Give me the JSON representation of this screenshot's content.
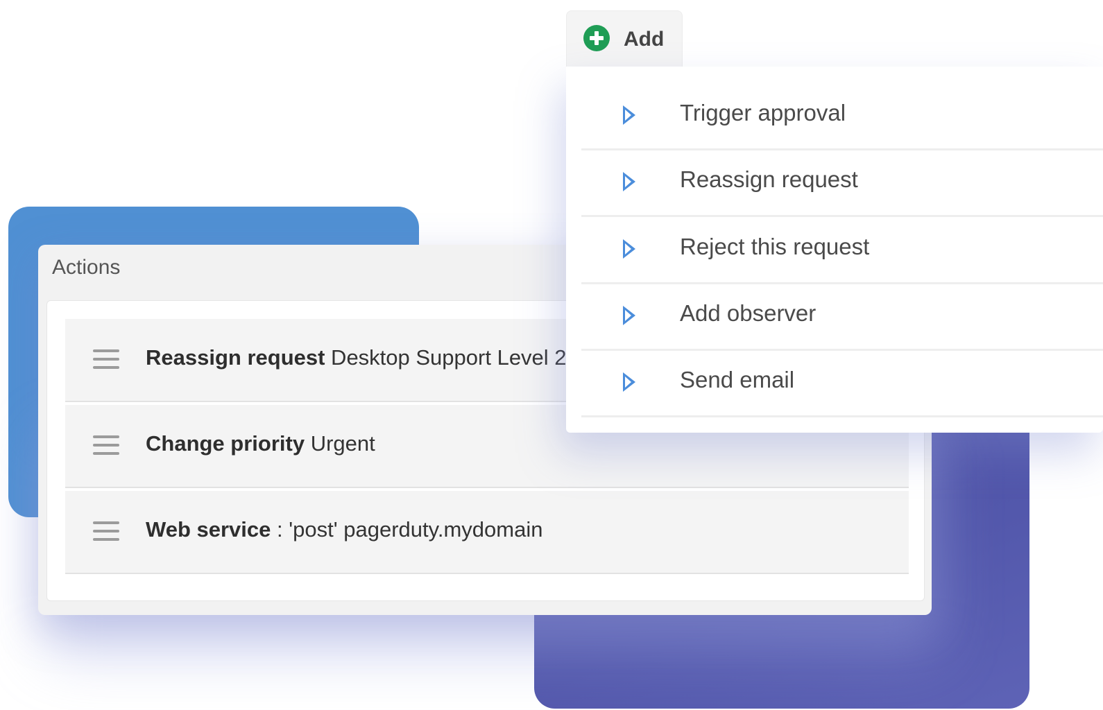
{
  "actions_panel": {
    "title": "Actions",
    "rows": [
      {
        "bold": "Reassign request",
        "rest": " Desktop Support Level 2 -"
      },
      {
        "bold": "Change priority",
        "rest": " Urgent"
      },
      {
        "bold": "Web service",
        "rest": " : 'post' pagerduty.mydomain"
      }
    ]
  },
  "add_menu": {
    "button_label": "Add",
    "items": [
      {
        "label": "Trigger approval"
      },
      {
        "label": "Reassign request"
      },
      {
        "label": "Reject this request"
      },
      {
        "label": "Add observer"
      },
      {
        "label": "Send email"
      }
    ]
  },
  "colors": {
    "blue_blob": "#5090d3",
    "purple_blob": "#4a4da0",
    "add_icon": "#1f9d55",
    "menu_arrow": "#4b8ddb"
  }
}
